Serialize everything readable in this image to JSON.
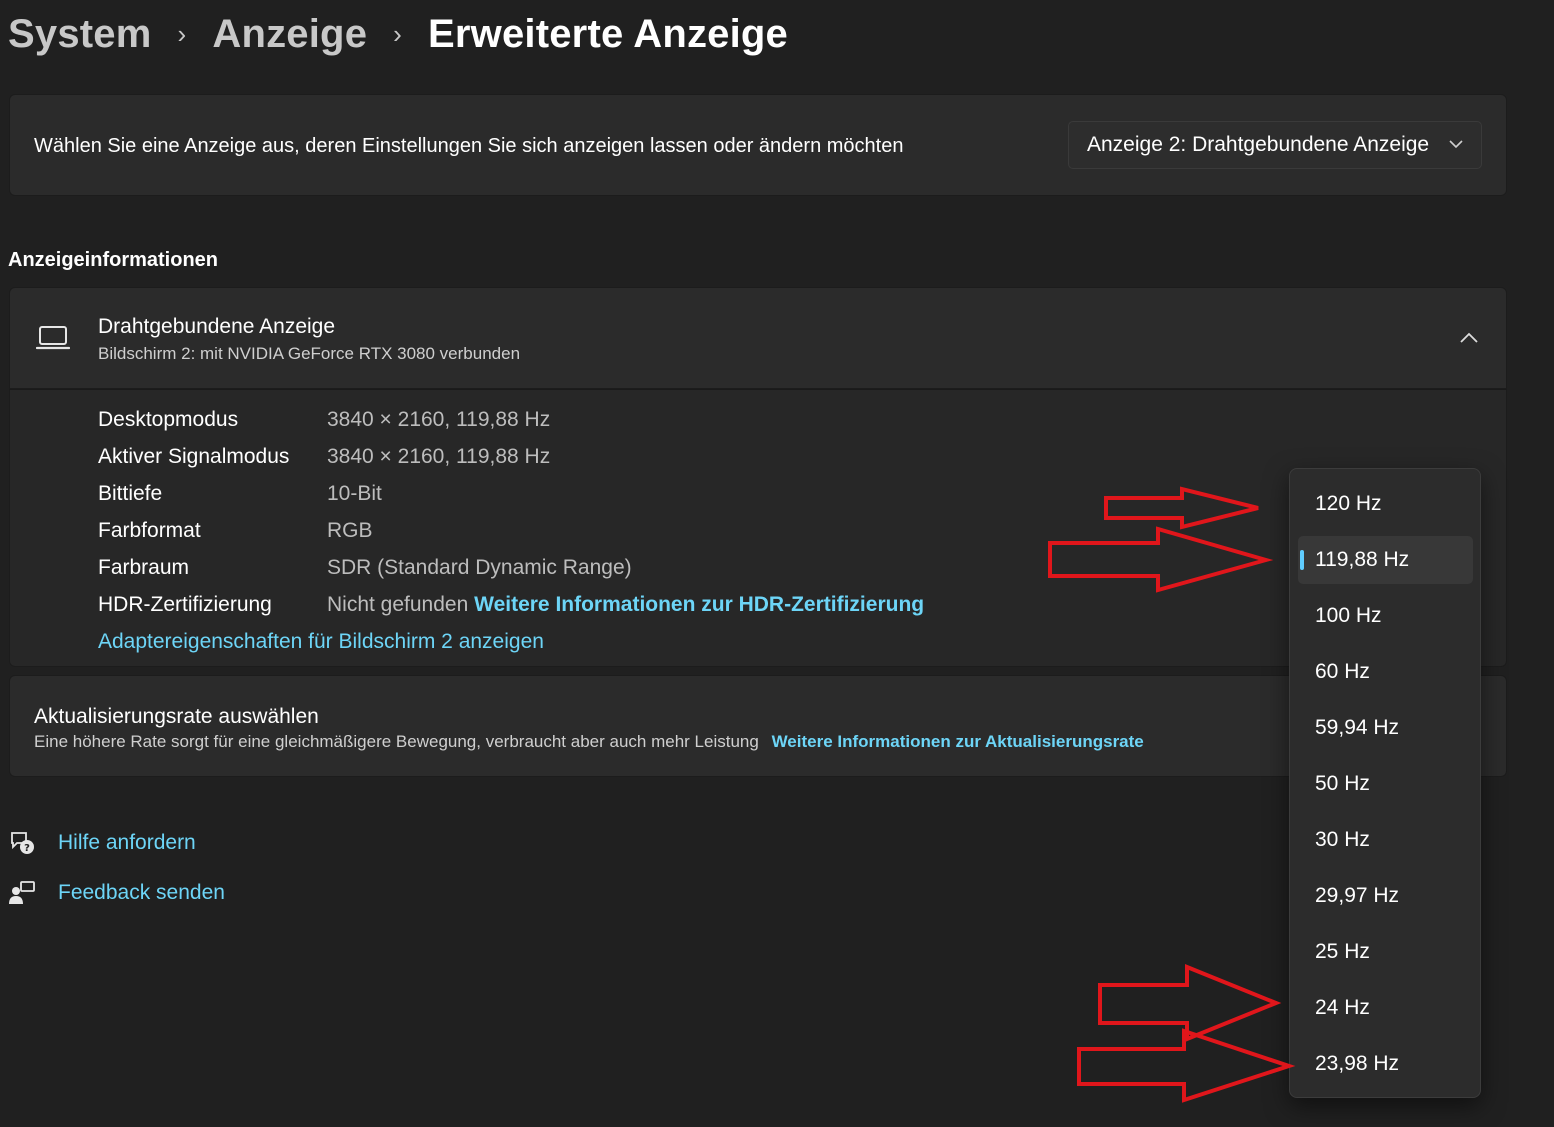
{
  "breadcrumb": {
    "items": [
      "System",
      "Anzeige"
    ],
    "current": "Erweiterte Anzeige",
    "separator": "›"
  },
  "display_select": {
    "prompt": "Wählen Sie eine Anzeige aus, deren Einstellungen Sie sich anzeigen lassen oder ändern möchten",
    "selected": "Anzeige 2: Drahtgebundene Anzeige"
  },
  "section_title": "Anzeigeinformationen",
  "display_info": {
    "title": "Drahtgebundene Anzeige",
    "subtitle": "Bildschirm 2: mit NVIDIA GeForce RTX 3080 verbunden",
    "rows": [
      {
        "label": "Desktopmodus",
        "value": "3840 × 2160, 119,88 Hz"
      },
      {
        "label": "Aktiver Signalmodus",
        "value": "3840 × 2160, 119,88 Hz"
      },
      {
        "label": "Bittiefe",
        "value": "10-Bit"
      },
      {
        "label": "Farbformat",
        "value": "RGB"
      },
      {
        "label": "Farbraum",
        "value": "SDR (Standard Dynamic Range)"
      },
      {
        "label": "HDR-Zertifizierung",
        "value": "Nicht gefunden",
        "link": "Weitere Informationen zur HDR-Zertifizierung"
      }
    ],
    "adapter_link": "Adaptereigenschaften für Bildschirm 2 anzeigen"
  },
  "refresh_rate": {
    "title": "Aktualisierungsrate auswählen",
    "description": "Eine höhere Rate sorgt für eine gleichmäßigere Bewegung, verbraucht aber auch mehr Leistung",
    "link": "Weitere Informationen zur Aktualisierungsrate",
    "options": [
      "120 Hz",
      "119,88 Hz",
      "100 Hz",
      "60 Hz",
      "59,94 Hz",
      "50 Hz",
      "30 Hz",
      "29,97 Hz",
      "25 Hz",
      "24 Hz",
      "23,98 Hz"
    ],
    "selected": "119,88 Hz"
  },
  "help": {
    "get_help": "Hilfe anfordern",
    "feedback": "Feedback senden"
  },
  "colors": {
    "background": "#202020",
    "card": "#2b2b2b",
    "accent_link": "#6dd5f7",
    "selection_indicator": "#60cdff",
    "annotation_arrow": "#e0161b"
  },
  "icons": {
    "monitor": "laptop-icon",
    "chevron_up": "chevron-up-icon",
    "chevron_down": "chevron-down-icon",
    "help": "help-chat-icon",
    "feedback": "feedback-icon"
  }
}
